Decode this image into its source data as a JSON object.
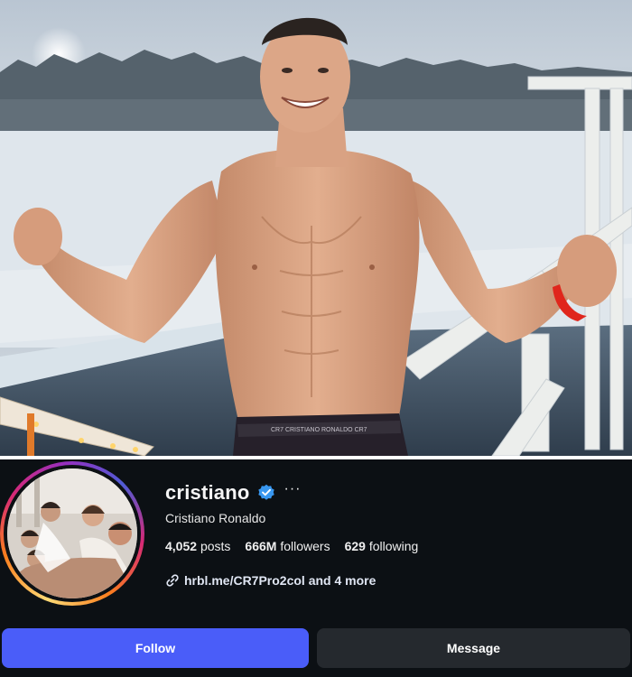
{
  "profile": {
    "username": "cristiano",
    "verified_icon": "verified-badge-icon",
    "more_label": "···",
    "full_name": "Cristiano Ronaldo",
    "stats": {
      "posts_count": "4,052",
      "posts_label": "posts",
      "followers_count": "666M",
      "followers_label": "followers",
      "following_count": "629",
      "following_label": "following"
    },
    "link": {
      "icon": "link-icon",
      "text": "hrbl.me/CR7Pro2col and 4 more"
    }
  },
  "actions": {
    "follow_label": "Follow",
    "message_label": "Message"
  },
  "photo": {
    "waistband_text": "CR7   CRISTIANO RONALDO   CR7"
  },
  "colors": {
    "background": "#0c1014",
    "follow_button": "#4a5df9",
    "message_button": "#25292e",
    "verified": "#3897f0"
  }
}
